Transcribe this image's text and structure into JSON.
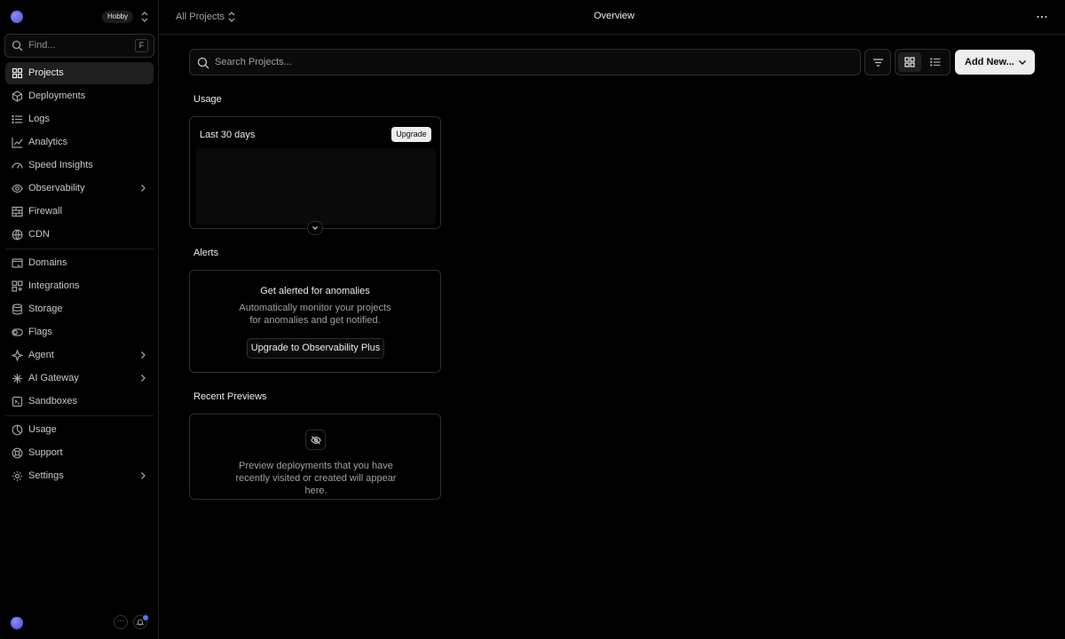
{
  "sidebar": {
    "team_plan": "Hobby",
    "find": {
      "placeholder": "Find...",
      "shortcut": "F"
    },
    "items": [
      {
        "label": "Projects",
        "icon": "grid-icon"
      },
      {
        "label": "Deployments",
        "icon": "cube-icon"
      },
      {
        "label": "Logs",
        "icon": "list-icon"
      },
      {
        "label": "Analytics",
        "icon": "chart-line-icon"
      },
      {
        "label": "Speed Insights",
        "icon": "gauge-icon"
      },
      {
        "label": "Observability",
        "icon": "eye-icon"
      },
      {
        "label": "Firewall",
        "icon": "brick-wall-icon"
      },
      {
        "label": "CDN",
        "icon": "globe-icon"
      },
      {
        "label": "Domains",
        "icon": "domain-icon"
      },
      {
        "label": "Integrations",
        "icon": "puzzle-icon"
      },
      {
        "label": "Storage",
        "icon": "database-icon"
      },
      {
        "label": "Flags",
        "icon": "toggle-icon"
      },
      {
        "label": "Agent",
        "icon": "sparkle-icon"
      },
      {
        "label": "AI Gateway",
        "icon": "ai-gateway-icon"
      },
      {
        "label": "Sandboxes",
        "icon": "box-icon"
      },
      {
        "label": "Usage",
        "icon": "pie-icon"
      },
      {
        "label": "Support",
        "icon": "lifebuoy-icon"
      },
      {
        "label": "Settings",
        "icon": "gear-icon"
      }
    ]
  },
  "topbar": {
    "scope": "All Projects",
    "title": "Overview"
  },
  "main": {
    "search_placeholder": "Search Projects...",
    "add_new_label": "Add New...",
    "usage": {
      "title": "Usage",
      "period": "Last 30 days",
      "upgrade_label": "Upgrade"
    },
    "alerts": {
      "title": "Alerts",
      "heading": "Get alerted for anomalies",
      "description": "Automatically monitor your projects for anomalies and get notified.",
      "button_label": "Upgrade to Observability Plus"
    },
    "previews": {
      "title": "Recent Previews",
      "description": "Preview deployments that you have recently visited or created will appear here."
    }
  },
  "colors": {
    "background": "#000000",
    "border": "#2e2e2e",
    "text": "#ededed",
    "muted": "#a1a1a1",
    "accent": "#4d7cff"
  }
}
